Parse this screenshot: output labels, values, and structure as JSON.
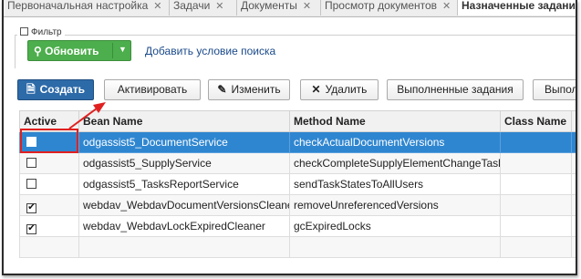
{
  "tabs": [
    {
      "label": "Первоначальная настройка",
      "closable": true,
      "active": false
    },
    {
      "label": "Задачи",
      "closable": true,
      "active": false
    },
    {
      "label": "Документы",
      "closable": true,
      "active": false
    },
    {
      "label": "Просмотр документов",
      "closable": true,
      "active": false
    },
    {
      "label": "Назначенные задания",
      "closable": false,
      "active": true
    }
  ],
  "filter": {
    "legend": "Фильтр",
    "refresh_label": "Обновить",
    "add_condition": "Добавить условие поиска"
  },
  "toolbar": {
    "create": "Создать",
    "activate": "Активировать",
    "edit": "Изменить",
    "delete": "Удалить",
    "completed": "Выполненные задания",
    "more": "Выпол"
  },
  "grid": {
    "columns": [
      "Active",
      "Bean Name",
      "Method Name",
      "Class Name",
      "S"
    ],
    "rows": [
      {
        "active": false,
        "bean": "odgassist5_DocumentService",
        "method": "checkActualDocumentVersions",
        "class": "",
        "selected": true
      },
      {
        "active": false,
        "bean": "odgassist5_SupplyService",
        "method": "checkCompleteSupplyElementChangeTasks",
        "class": "",
        "selected": false
      },
      {
        "active": false,
        "bean": "odgassist5_TasksReportService",
        "method": "sendTaskStatesToAllUsers",
        "class": "",
        "selected": false
      },
      {
        "active": true,
        "bean": "webdav_WebdavDocumentVersionsCleaner",
        "method": "removeUnreferencedVersions",
        "class": "",
        "selected": false
      },
      {
        "active": true,
        "bean": "webdav_WebdavLockExpiredCleaner",
        "method": "gcExpiredLocks",
        "class": "",
        "selected": false
      }
    ]
  },
  "colors": {
    "selection": "#2f86d0",
    "refresh": "#4cae4c",
    "primary": "#2d6aa8",
    "annotation": "#e02020"
  }
}
